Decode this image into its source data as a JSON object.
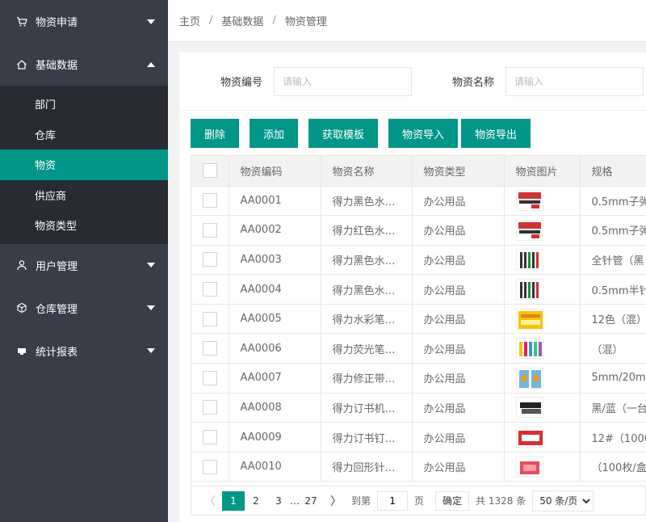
{
  "colors": {
    "accent": "#009688",
    "sidebar_bg": "#393d49",
    "submenu_bg": "#282b33"
  },
  "sidebar": {
    "items": [
      {
        "label": "物资申请",
        "icon": "cart-icon",
        "expanded": false
      },
      {
        "label": "基础数据",
        "icon": "home-icon",
        "expanded": true
      },
      {
        "label": "用户管理",
        "icon": "user-icon",
        "expanded": false
      },
      {
        "label": "仓库管理",
        "icon": "box-icon",
        "expanded": false
      },
      {
        "label": "统计报表",
        "icon": "chart-icon",
        "expanded": false
      }
    ],
    "sub_items": [
      "部门",
      "仓库",
      "物资",
      "供应商",
      "物资类型"
    ],
    "active_sub": "物资"
  },
  "breadcrumb": {
    "home": "主页",
    "level1": "基础数据",
    "current": "物资管理",
    "separator": "/"
  },
  "search": {
    "code_label": "物资编号",
    "code_placeholder": "请输入",
    "name_label": "物资名称",
    "name_placeholder": "请输入"
  },
  "toolbar": {
    "delete": "删除",
    "add": "添加",
    "template": "获取模板",
    "import": "物资导入",
    "export": "物资导出"
  },
  "table": {
    "headers": [
      "物资编码",
      "物资名称",
      "物资类型",
      "物资图片",
      "规格"
    ],
    "rows": [
      {
        "code": "AA0001",
        "name": "得力黑色水…",
        "type": "办公用品",
        "image": "pens-box-icon",
        "spec": "0.5mm子弹"
      },
      {
        "code": "AA0002",
        "name": "得力红色水…",
        "type": "办公用品",
        "image": "pens-box-icon",
        "spec": "0.5mm子弹"
      },
      {
        "code": "AA0003",
        "name": "得力黑色水…",
        "type": "办公用品",
        "image": "pens-icon",
        "spec": "全针管（黑"
      },
      {
        "code": "AA0004",
        "name": "得力黑色水…",
        "type": "办公用品",
        "image": "pens-icon",
        "spec": "0.5mm半针"
      },
      {
        "code": "AA0005",
        "name": "得力水彩笔…",
        "type": "办公用品",
        "image": "watercolor-pens-icon",
        "spec": "12色（混）"
      },
      {
        "code": "AA0006",
        "name": "得力荧光笔…",
        "type": "办公用品",
        "image": "highlighter-icon",
        "spec": "（混）"
      },
      {
        "code": "AA0007",
        "name": "得力修正带…",
        "type": "办公用品",
        "image": "correction-tape-icon",
        "spec": "5mm/20m…"
      },
      {
        "code": "AA0008",
        "name": "得力订书机…",
        "type": "办公用品",
        "image": "stapler-icon",
        "spec": "黑/蓝（一台"
      },
      {
        "code": "AA0009",
        "name": "得力订书钉…",
        "type": "办公用品",
        "image": "staples-icon",
        "spec": "12#（1000…"
      },
      {
        "code": "AA0010",
        "name": "得力回形针…",
        "type": "办公用品",
        "image": "paper-clips-icon",
        "spec": "（100枚/盒）"
      }
    ]
  },
  "pager": {
    "prev": "〈",
    "next": "〉",
    "pages": [
      "1",
      "2",
      "3",
      "…",
      "27"
    ],
    "current": "1",
    "goto_label": "到第",
    "goto_value": "1",
    "page_unit": "页",
    "confirm": "确定",
    "total": "共 1328 条",
    "page_size": "50 条/页"
  }
}
